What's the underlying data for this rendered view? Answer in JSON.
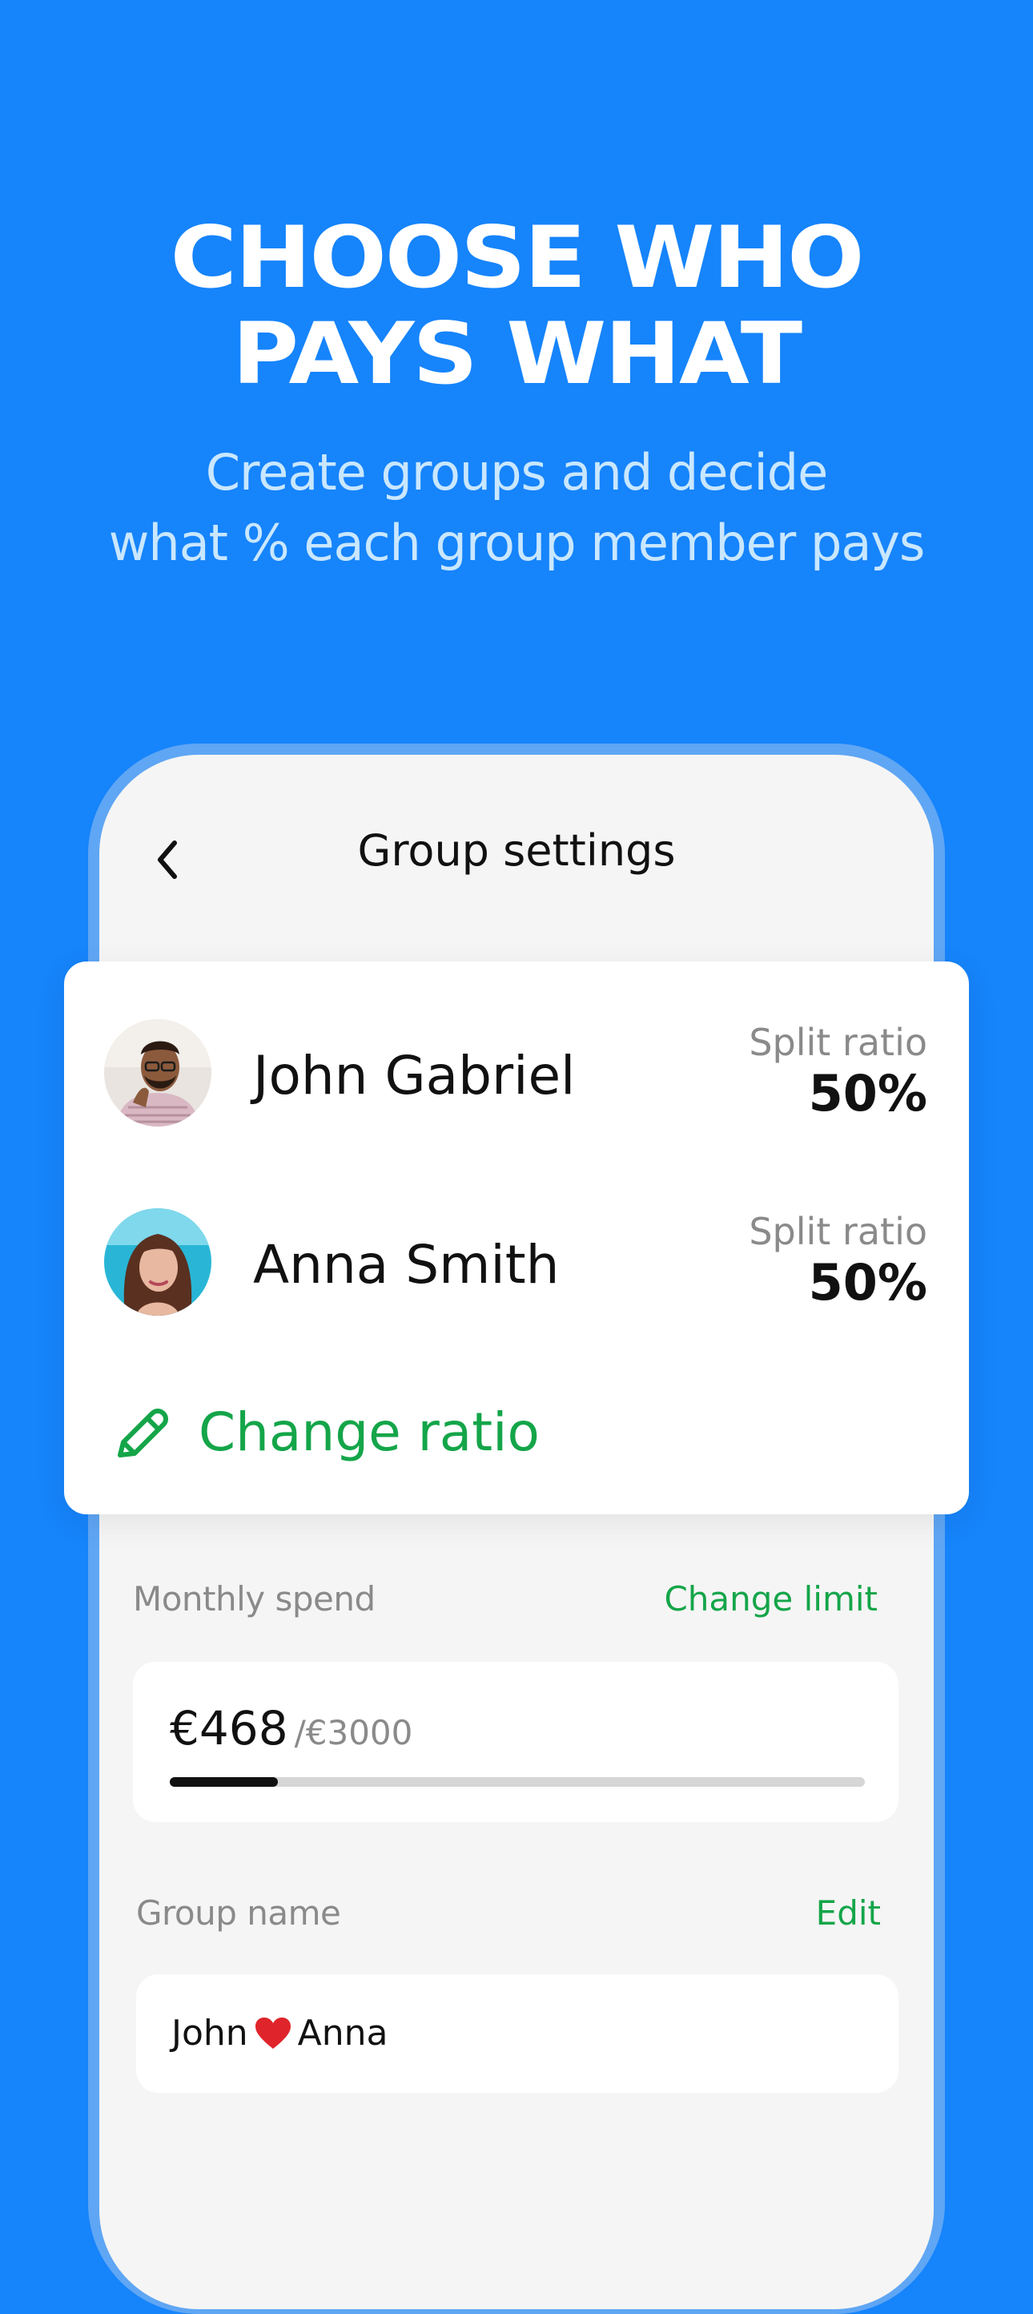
{
  "hero": {
    "headline_line1": "CHOOSE WHO",
    "headline_line2": "PAYS WHAT",
    "subline_line1": "Create groups and decide",
    "subline_line2": "what % each group member pays"
  },
  "screen": {
    "title": "Group settings",
    "back_icon": "chevron-left-icon"
  },
  "members": [
    {
      "name": "John Gabriel",
      "split_label": "Split ratio",
      "split_value": "50%",
      "avatar": "avatar-john"
    },
    {
      "name": "Anna Smith",
      "split_label": "Split ratio",
      "split_value": "50%",
      "avatar": "avatar-anna"
    }
  ],
  "change_ratio": {
    "label": "Change ratio",
    "icon": "pencil-icon"
  },
  "monthly_spend": {
    "label": "Monthly spend",
    "action": "Change limit",
    "current": "€468",
    "limit": "/€3000",
    "progress_fraction": 0.156
  },
  "group_name": {
    "label": "Group name",
    "action": "Edit",
    "value_part1": "John",
    "value_part2": "Anna",
    "separator_icon": "heart-icon"
  },
  "colors": {
    "background": "#1684FB",
    "accent_green": "#14A549",
    "subline": "#C9E7FF"
  }
}
